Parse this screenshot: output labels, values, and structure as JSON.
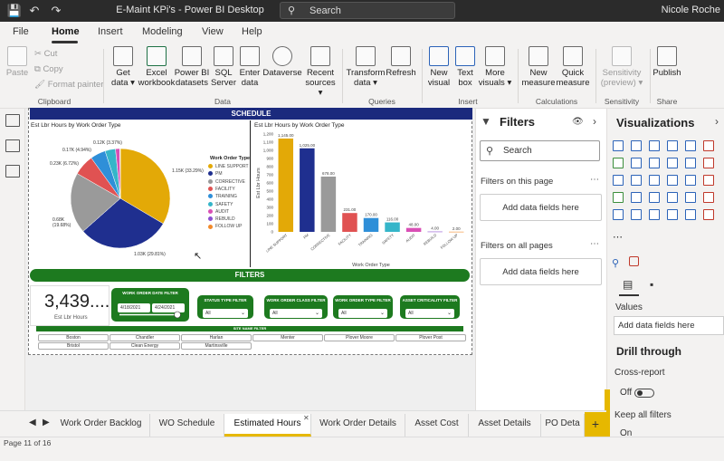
{
  "window": {
    "title": "E-Maint KPi's - Power BI Desktop",
    "search": "Search",
    "user": "Nicole Roche"
  },
  "menu": {
    "tabs": [
      "File",
      "Home",
      "Insert",
      "Modeling",
      "View",
      "Help"
    ]
  },
  "ribbon": {
    "paste": "Paste",
    "cut": "Cut",
    "copy": "Copy",
    "format_painter": "Format painter",
    "get_data": [
      "Get",
      "data"
    ],
    "excel": [
      "Excel",
      "workbook"
    ],
    "powerbi": [
      "Power BI",
      "datasets"
    ],
    "sql": [
      "SQL",
      "Server"
    ],
    "enter": [
      "Enter",
      "data"
    ],
    "dataverse": [
      "Dataverse"
    ],
    "recent": [
      "Recent",
      "sources"
    ],
    "transform": [
      "Transform",
      "data"
    ],
    "refresh": [
      "Refresh"
    ],
    "new_visual": [
      "New",
      "visual"
    ],
    "text_box": [
      "Text",
      "box"
    ],
    "more_visuals": [
      "More",
      "visuals"
    ],
    "new_measure": [
      "New",
      "measure"
    ],
    "quick_measure": [
      "Quick",
      "measure"
    ],
    "sensitivity": [
      "Sensitivity",
      "(preview)"
    ],
    "publish": [
      "Publish"
    ],
    "groups": {
      "clipboard": "Clipboard",
      "data": "Data",
      "queries": "Queries",
      "insert": "Insert",
      "calculations": "Calculations",
      "sensitivity": "Sensitivity",
      "share": "Share"
    }
  },
  "report": {
    "schedule_header": "SCHEDULE",
    "pie_title": "Est Lbr Hours by Work Order Type",
    "bar_title": "Est Lbr Hours by Work Order Type",
    "filters_header": "FILTERS",
    "kpi_value": "3,439....",
    "kpi_label": "Est Lbr Hours",
    "date_filter_title": "WORK ORDER DATE FILTER",
    "date_from": "4/18/2021",
    "date_to": "4/24/2021",
    "slicers": [
      {
        "title": "STATUS TYPE FILTER",
        "value": "All"
      },
      {
        "title": "WORK ORDER CLASS FILTER",
        "value": "All"
      },
      {
        "title": "WORK ORDER TYPE FILTER",
        "value": "All"
      },
      {
        "title": "ASSET CRITICALITY FILTER",
        "value": "All"
      }
    ],
    "site_filter_title": "SITE NAME FILTER",
    "sites": [
      "Boston",
      "Chandler",
      "Harlan",
      "Menter",
      "Plover Moore",
      "Plover Post",
      "Bristol",
      "Clean Energy",
      "Martinsville"
    ]
  },
  "chart_data": [
    {
      "type": "pie",
      "title": "Est Lbr Hours by Work Order Type",
      "legend_title": "Work Order Type",
      "legend_placement": "right",
      "categories": [
        "LINE SUPPORT",
        "PM",
        "CORRECTIVE",
        "FACILITY",
        "TRAINING",
        "SAFETY",
        "AUDIT",
        "REBUILD",
        "FOLLOW UP"
      ],
      "values": [
        1145,
        1025,
        678,
        231,
        170,
        116,
        48,
        4,
        2
      ],
      "colors": [
        "#e3a907",
        "#1f2f8f",
        "#9a9a9a",
        "#e05252",
        "#2f8fd8",
        "#35b5c9",
        "#d94fb5",
        "#8c4fd0",
        "#f28a2b"
      ],
      "labels": [
        "1.15K (33.29%)",
        "1.03K (29.81%)",
        "0.68K (19.68%)",
        "0.23K (6.72%)",
        "0.17K (4.94%)",
        "0.12K (3.37%)"
      ]
    },
    {
      "type": "bar",
      "title": "Est Lbr Hours by Work Order Type",
      "xlabel": "Work Order Type",
      "ylabel": "Est Lbr Hours",
      "categories": [
        "LINE SUPPORT",
        "PM",
        "CORRECTIVE",
        "FACILITY",
        "TRAINING",
        "SAFETY",
        "AUDIT",
        "REBUILD",
        "FOLLOW UP"
      ],
      "values": [
        1145,
        1025,
        678,
        231,
        170,
        116,
        48,
        4,
        2
      ],
      "data_labels": [
        "1,145.00",
        "1,025.00",
        "678.00",
        "231.00",
        "170.00",
        "116.00",
        "48.00",
        "4.00",
        "2.00"
      ],
      "colors": [
        "#e3a907",
        "#1f2f8f",
        "#9a9a9a",
        "#e05252",
        "#2f8fd8",
        "#35b5c9",
        "#d94fb5",
        "#8c4fd0",
        "#f28a2b"
      ],
      "ylim": [
        0,
        1200
      ],
      "yticks": [
        "0",
        "100",
        "200",
        "300",
        "400",
        "500",
        "600",
        "700",
        "800",
        "900",
        "1,000",
        "1,100",
        "1,200"
      ]
    }
  ],
  "filters_pane": {
    "title": "Filters",
    "search": "Search",
    "on_page": "Filters on this page",
    "on_all": "Filters on all pages",
    "add_fields": "Add data fields here"
  },
  "viz_pane": {
    "title": "Visualizations",
    "values": "Values",
    "add_fields": "Add data fields here",
    "drill_through": "Drill through",
    "cross_report": "Cross-report",
    "off": "Off",
    "keep_filters": "Keep all filters",
    "on": "On"
  },
  "page_tabs": [
    "Work Order Backlog",
    "WO Schedule",
    "Estimated Hours",
    "Work Order Details",
    "Asset Cost",
    "Asset Details",
    "PO Deta"
  ],
  "status": {
    "page": "Page 11 of 16"
  }
}
